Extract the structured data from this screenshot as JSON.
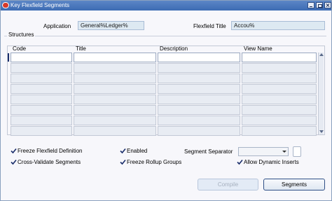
{
  "window": {
    "title": "Key Flexfield Segments"
  },
  "header": {
    "application_label": "Application",
    "application_value": "General%Ledger%",
    "flexfield_title_label": "Flexfield Title",
    "flexfield_title_value": "Accou%"
  },
  "structures": {
    "section_label": "Structures",
    "columns": [
      "Code",
      "Title",
      "Description",
      "View Name"
    ],
    "row_count": 8
  },
  "options": {
    "freeze_flexfield_definition": {
      "label": "Freeze Flexfield Definition",
      "checked": true
    },
    "cross_validate_segments": {
      "label": "Cross-Validate Segments",
      "checked": true
    },
    "enabled": {
      "label": "Enabled",
      "checked": true
    },
    "freeze_rollup_groups": {
      "label": "Freeze Rollup Groups",
      "checked": true
    },
    "allow_dynamic_inserts": {
      "label": "Allow Dynamic Inserts",
      "checked": true
    },
    "segment_separator_label": "Segment Separator",
    "segment_separator_value": ""
  },
  "buttons": {
    "compile": "Compile",
    "segments": "Segments"
  },
  "colors": {
    "titlebar": "#3d6bb3",
    "field_bg": "#dde9f2",
    "checkmark": "#1b2e6b"
  }
}
